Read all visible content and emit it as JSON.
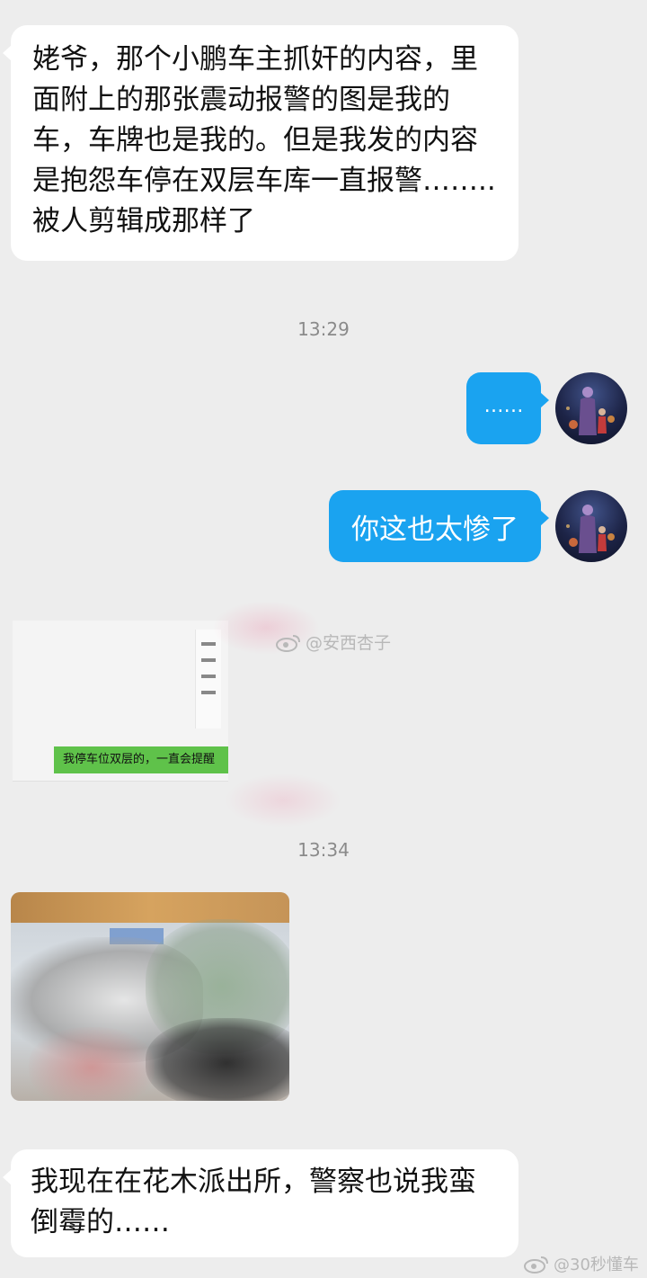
{
  "messages": {
    "m1": "姥爷，那个小鹏车主抓奸的内容，里面附上的那张震动报警的图是我的车，车牌也是我的。但是我发的内容是抱怨车停在双层车库一直报警……..被人剪辑成那样了",
    "m2": "……",
    "m3": "你这也太惨了",
    "m4": "我现在在花木派出所，警察也说我蛮倒霉的……"
  },
  "timestamps": {
    "t1": "13:29",
    "t2": "13:34"
  },
  "shared_card": {
    "caption": "我停车位双层的，一直会提醒"
  },
  "watermarks": {
    "w1": "@安西杏子",
    "w2": "@30秒懂车"
  },
  "colors": {
    "background": "#ededed",
    "outgoing_bubble": "#1aa3f0",
    "incoming_bubble": "#ffffff",
    "card_caption_bg": "#5fc24a"
  }
}
